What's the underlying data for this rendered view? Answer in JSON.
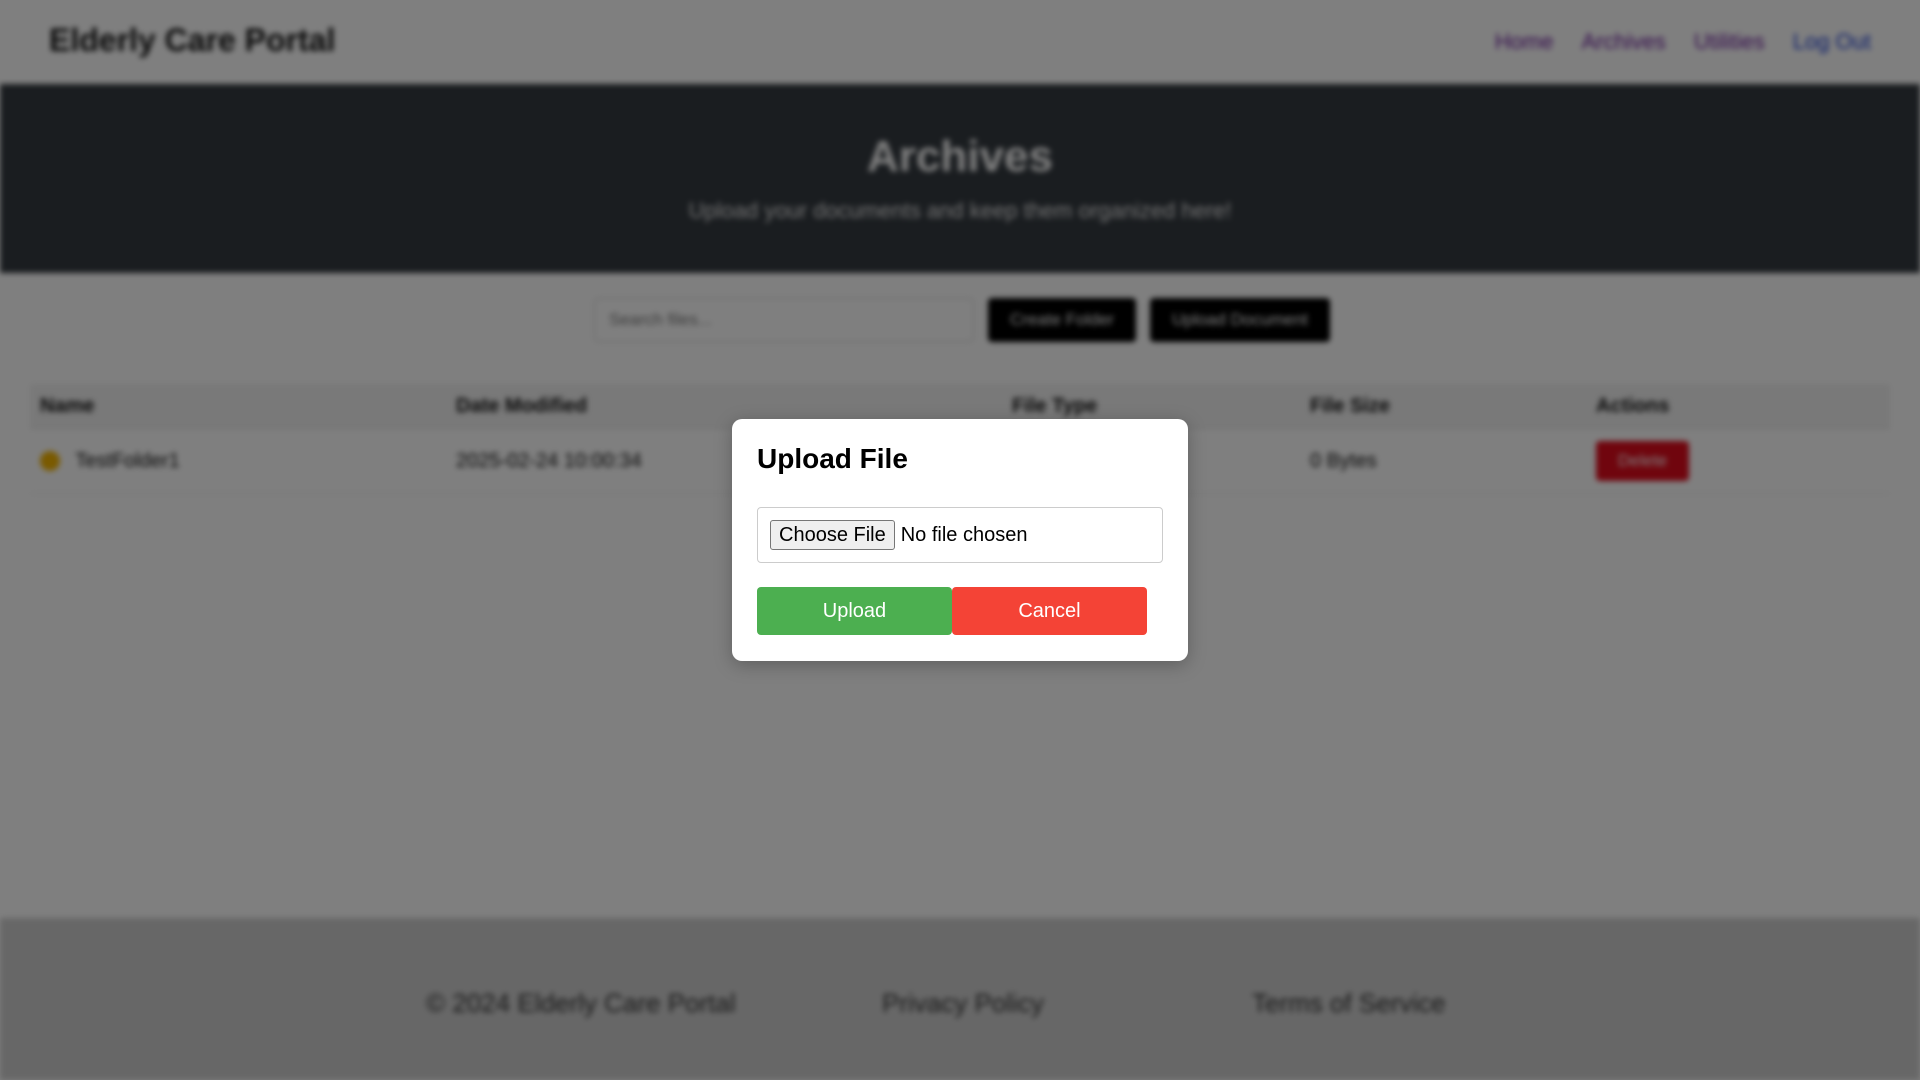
{
  "header": {
    "brand": "Elderly Care Portal",
    "nav": [
      "Home",
      "Archives",
      "Utilities",
      "Log Out"
    ]
  },
  "hero": {
    "title": "Archives",
    "subtitle": "Upload your documents and keep them organized here!"
  },
  "toolbar": {
    "search_placeholder": "Search files...",
    "create_folder_label": "Create Folder",
    "upload_document_label": "Upload Document"
  },
  "table": {
    "columns": [
      "Name",
      "Date Modified",
      "File Type",
      "File Size",
      "Actions"
    ],
    "rows": [
      {
        "icon": "folder-icon",
        "name": "TestFolder1",
        "date_modified": "2025-02-24 10:00:34",
        "file_type": "",
        "file_size": "0 Bytes",
        "action_label": "Delete"
      }
    ]
  },
  "footer": {
    "copyright": "© 2024 Elderly Care Portal",
    "privacy": "Privacy Policy",
    "terms": "Terms of Service"
  },
  "modal": {
    "title": "Upload File",
    "choose_file_label": "Choose File",
    "file_status": "No file chosen",
    "upload_label": "Upload",
    "cancel_label": "Cancel"
  },
  "colors": {
    "hero_bg": "#343a40",
    "upload_button": "#4caf50",
    "cancel_button": "#f44336",
    "delete_button": "#e00b1c"
  }
}
